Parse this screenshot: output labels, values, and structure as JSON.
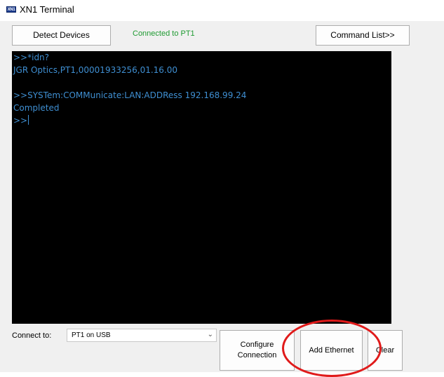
{
  "window": {
    "title": "XN1 Terminal",
    "icon_text": "XN1",
    "icon": "app-icon"
  },
  "toolbar": {
    "detect_devices_label": "Detect Devices",
    "status_text": "Connected to PT1",
    "command_list_label": "Command List>>"
  },
  "terminal": {
    "lines": [
      ">>*idn?",
      "JGR Optics,PT1,00001933256,01.16.00",
      "",
      ">>SYSTem:COMMunicate:LAN:ADDRess 192.168.99.24",
      "Completed",
      ">>"
    ]
  },
  "bottom": {
    "connect_label": "Connect to:",
    "connect_selected": "PT1 on USB",
    "configure_label": "Configure Connection",
    "add_ethernet_label": "Add Ethernet",
    "clear_label": "Clear"
  },
  "colors": {
    "status": "#1e9a31",
    "terminal_text": "#3f8fd2",
    "terminal_bg": "#000000",
    "annotation": "#e01a1a"
  }
}
